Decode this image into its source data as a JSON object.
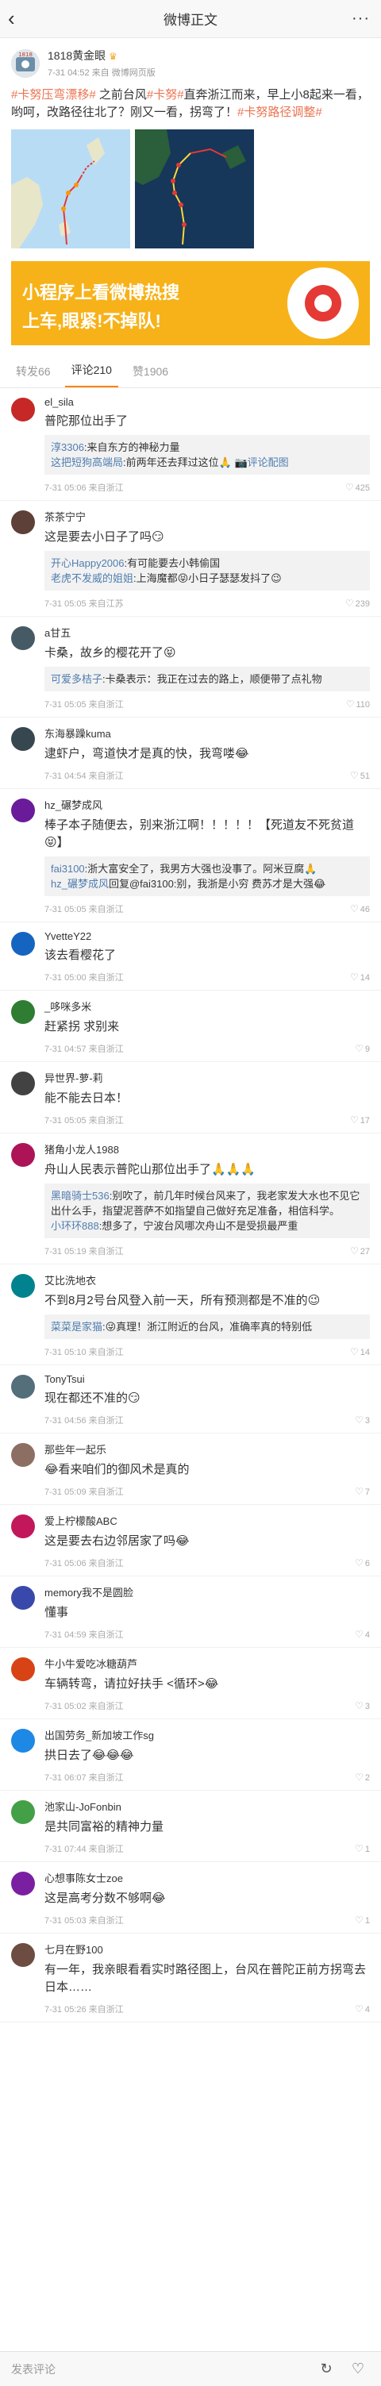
{
  "header": {
    "back": "‹",
    "title": "微博正文",
    "more": "···"
  },
  "post": {
    "author": "1818黄金眼",
    "crown": "♛",
    "time": "7-31 04:52",
    "source_prefix": "来自",
    "source": "微博网页版",
    "text_tag1": "#卡努压弯漂移#",
    "text_1": " 之前台风",
    "text_tag2": "#卡努#",
    "text_2": "直奔浙江而来，早上小8起来一看，哟呵，改路径往北了？刚又一看，拐弯了！",
    "text_tag3": "#卡努路径调整#"
  },
  "banner": {
    "line1": "小程序上看微博热搜",
    "line2": "上车,眼紧!不掉队!"
  },
  "tabs": [
    {
      "label": "转发66"
    },
    {
      "label": "评论210"
    },
    {
      "label": "赞1906"
    }
  ],
  "comments": [
    {
      "name": "el_sila",
      "text": "普陀那位出手了",
      "time": "7-31 05:06 来自浙江",
      "likes": "425",
      "replies": [
        {
          "user": "淳3306",
          "text": ":来自东方的神秘力量",
          "link": ""
        },
        {
          "user": "这把短狗高端局",
          "text": ":前两年还去拜过这位🙏",
          "link": " 📷评论配图"
        }
      ]
    },
    {
      "name": "茶茶宁宁",
      "text": "这是要去小日子了吗😏",
      "time": "7-31 05:05 来自江苏",
      "likes": "239",
      "replies": [
        {
          "user": "开心Happy2006",
          "text": ":有可能要去小韩偷国",
          "link": ""
        },
        {
          "user": "老虎不发威的姐姐",
          "text": ":上海魔都😝小日子瑟瑟发抖了😉",
          "link": ""
        }
      ]
    },
    {
      "name": "a甘五",
      "text": "卡桑，故乡的樱花开了😝",
      "time": "7-31 05:05 来自浙江",
      "likes": "110",
      "replies": [
        {
          "user": "可爱多桔子",
          "text": ":卡桑表示：我正在过去的路上，顺便带了点礼物",
          "link": ""
        }
      ]
    },
    {
      "name": "东海暴躁kuma",
      "text": "逮虾户，弯道快才是真的快，我弯喽😂",
      "time": "7-31 04:54 来自浙江",
      "likes": "51",
      "replies": []
    },
    {
      "name": "hz_碾梦成风",
      "text": "棒子本子随便去，别来浙江啊！！！！！【死道友不死贫道😝】",
      "time": "7-31 05:05 来自浙江",
      "likes": "46",
      "replies": [
        {
          "user": "fai3100",
          "text": ":浙大富安全了，我男方大强也没事了。阿米豆腐🙏",
          "link": ""
        },
        {
          "user": "hz_碾梦成风",
          "text": "回复@fai3100:别，我浙是小穷 费苏才是大强😂",
          "link": ""
        }
      ]
    },
    {
      "name": "YvetteY22",
      "text": "该去看樱花了",
      "time": "7-31 05:00 来自浙江",
      "likes": "14",
      "replies": []
    },
    {
      "name": "_哆咪多米",
      "text": "赶紧拐 求别来",
      "time": "7-31 04:57 来自浙江",
      "likes": "9",
      "replies": []
    },
    {
      "name": "异世界-萝-莉",
      "text": "能不能去日本！",
      "time": "7-31 05:05 来自浙江",
      "likes": "17",
      "replies": []
    },
    {
      "name": "猪角小龙人1988",
      "text": "舟山人民表示普陀山那位出手了🙏🙏🙏",
      "time": "7-31 05:19 来自浙江",
      "likes": "27",
      "replies": [
        {
          "user": "黑暗骑士536",
          "text": ":别吹了，前几年时候台风来了，我老家发大水也不见它出什么手，指望泥菩萨不如指望自己做好充足准备，相信科学。",
          "link": ""
        },
        {
          "user": "小环环888",
          "text": ":想多了，宁波台风哪次舟山不是受损最严重",
          "link": ""
        }
      ]
    },
    {
      "name": "艾比洗地衣",
      "text": "不到8月2号台风登入前一天，所有预测都是不准的😉",
      "time": "7-31 05:10 来自浙江",
      "likes": "14",
      "replies": [
        {
          "user": "菜菜是家猫",
          "text": ":😜真理！浙江附近的台风，准确率真的特别低",
          "link": ""
        }
      ]
    },
    {
      "name": "TonyTsui",
      "text": "现在都还不准的😏",
      "time": "7-31 04:56 来自浙江",
      "likes": "3",
      "replies": []
    },
    {
      "name": "那些年一起乐",
      "text": "😂看来咱们的御风术是真的",
      "time": "7-31 05:09 来自浙江",
      "likes": "7",
      "replies": []
    },
    {
      "name": "爱上柠檬酸ABC",
      "text": "这是要去右边邻居家了吗😂",
      "time": "7-31 05:06 来自浙江",
      "likes": "6",
      "replies": []
    },
    {
      "name": "memory我不是圆脸",
      "text": "懂事",
      "time": "7-31 04:59 来自浙江",
      "likes": "4",
      "replies": []
    },
    {
      "name": "牛小牛爱吃冰糖葫芦",
      "text": "车辆转弯，请拉好扶手 <循环>😂",
      "time": "7-31 05:02 来自浙江",
      "likes": "3",
      "replies": []
    },
    {
      "name": "出国劳务_新加坡工作sg",
      "text": "拱日去了😂😂😂",
      "time": "7-31 06:07 来自浙江",
      "likes": "2",
      "replies": []
    },
    {
      "name": "池家山-JoFonbin",
      "text": "是共同富裕的精神力量",
      "time": "7-31 07:44 来自浙江",
      "likes": "1",
      "replies": []
    },
    {
      "name": "心想事陈女士zoe",
      "text": "这是高考分数不够啊😂",
      "time": "7-31 05:03 来自浙江",
      "likes": "1",
      "replies": []
    },
    {
      "name": "七月在野100",
      "text": "有一年，我亲眼看看实时路径图上，台风在普陀正前方拐弯去日本……",
      "time": "7-31 05:26 来自浙江",
      "likes": "4",
      "replies": []
    }
  ],
  "bottombar": {
    "hint": "发表评论",
    "share_icon": "↻",
    "like_icon": "♡"
  },
  "colors": {
    "accent": "#ff8200",
    "link": "#507daf",
    "tag": "#eb7350",
    "banner": "#f7b21a"
  }
}
